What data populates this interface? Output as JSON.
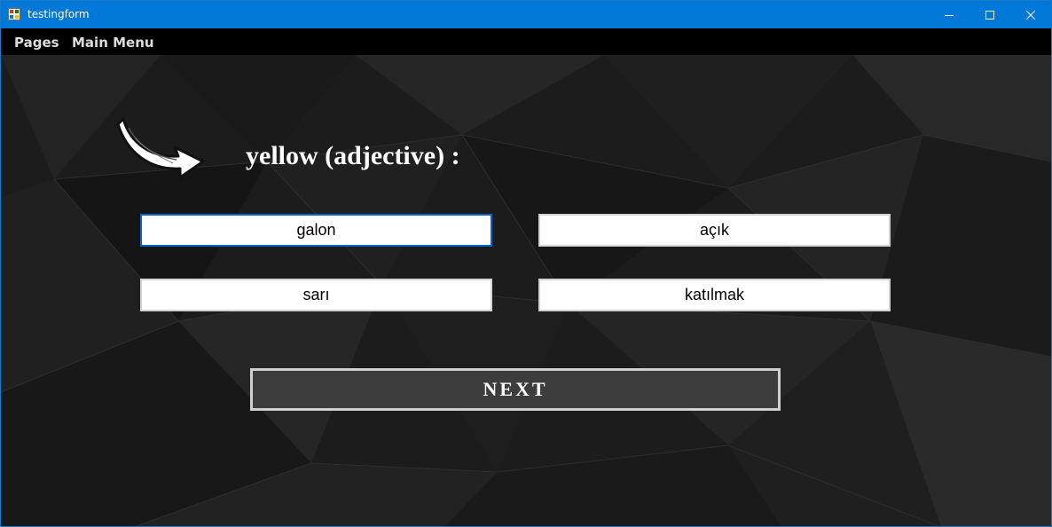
{
  "window": {
    "title": "testingform",
    "controls": {
      "minimize": "minimize-icon",
      "maximize": "maximize-icon",
      "close": "close-icon"
    }
  },
  "menu": {
    "items": [
      {
        "label": "Pages"
      },
      {
        "label": "Main Menu"
      }
    ]
  },
  "quiz": {
    "question": "yellow (adjective) :",
    "answers": [
      {
        "label": "galon"
      },
      {
        "label": "açık"
      },
      {
        "label": "sarı"
      },
      {
        "label": "katılmak"
      }
    ],
    "focused_answer": "galon",
    "next_label": "NEXT"
  },
  "colors": {
    "titlebar": "#0078d7",
    "menubar": "#000000",
    "background": "#1c1c1c",
    "answer_background": "#ffffff",
    "answer_focus_border": "#0a64c8",
    "next_background": "#3d3d3d"
  }
}
